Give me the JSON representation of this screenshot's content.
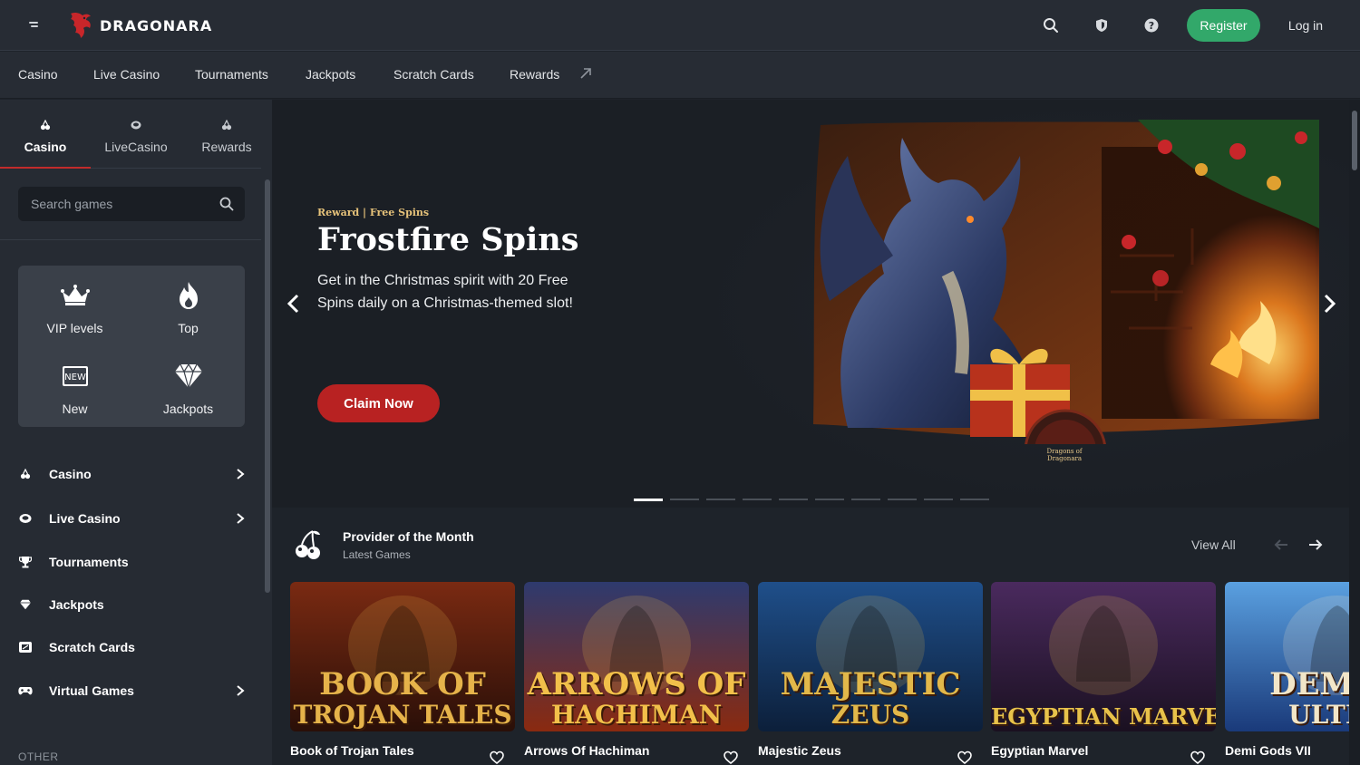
{
  "brand": {
    "name": "DRAGONARA"
  },
  "header": {
    "register_label": "Register",
    "login_label": "Log in",
    "icons": [
      "search-icon",
      "shield-icon",
      "help-icon"
    ]
  },
  "nav": {
    "items": [
      "Casino",
      "Live Casino",
      "Tournaments",
      "Jackpots",
      "Scratch Cards",
      "Rewards"
    ]
  },
  "sidebar": {
    "tabs": [
      {
        "label": "Casino",
        "icon": "cherries-icon",
        "active": true
      },
      {
        "label": "LiveCasino",
        "icon": "chip-icon",
        "active": false
      },
      {
        "label": "Rewards",
        "icon": "gift-icon",
        "active": false
      }
    ],
    "search": {
      "placeholder": "Search games",
      "value": ""
    },
    "quick": [
      {
        "label": "VIP levels",
        "icon": "crown-icon"
      },
      {
        "label": "Top",
        "icon": "flame-icon"
      },
      {
        "label": "New",
        "icon": "new-badge-icon"
      },
      {
        "label": "Jackpots",
        "icon": "diamond-icon"
      }
    ],
    "links": [
      {
        "label": "Casino",
        "icon": "cherries-icon",
        "expandable": true
      },
      {
        "label": "Live Casino",
        "icon": "chip-icon",
        "expandable": true
      },
      {
        "label": "Tournaments",
        "icon": "trophy-icon",
        "expandable": false
      },
      {
        "label": "Jackpots",
        "icon": "diamond-icon",
        "expandable": false
      },
      {
        "label": "Scratch Cards",
        "icon": "ticket-icon",
        "expandable": false
      },
      {
        "label": "Virtual Games",
        "icon": "gamepad-icon",
        "expandable": true
      }
    ],
    "other_label": "OTHER"
  },
  "hero": {
    "tag": "Reward | Free Spins",
    "title": "Frostfire Spins",
    "description": "Get in the Christmas spirit with 20 Free Spins daily on a Christmas-themed slot!",
    "cta": "Claim Now",
    "slide_count": 10,
    "active_slide": 1,
    "seal_text": "Dragons of Dragonara"
  },
  "provider_section": {
    "title": "Provider of the Month",
    "subtitle": "Latest Games",
    "view_all": "View All"
  },
  "games": [
    {
      "name": "Book of Trojan Tales",
      "art_line1": "BOOK OF",
      "art_line2": "TROJAN TALES",
      "bg1": "#7a2a12",
      "bg2": "#2a0f08",
      "accent": "#e6b34a"
    },
    {
      "name": "Arrows Of Hachiman",
      "art_line1": "ARROWS OF",
      "art_line2": "HACHIMAN",
      "bg1": "#2e3a6e",
      "bg2": "#8a2a10",
      "accent": "#f2c04a"
    },
    {
      "name": "Majestic Zeus",
      "art_line1": "MAJESTIC",
      "art_line2": "ZEUS",
      "bg1": "#1f4f8a",
      "bg2": "#0c1f3a",
      "accent": "#e2b84a"
    },
    {
      "name": "Egyptian Marvel",
      "art_line1": "EGYPTIAN MARVEL",
      "art_line2": "",
      "bg1": "#4a2a5e",
      "bg2": "#1a1020",
      "accent": "#e8c24a"
    },
    {
      "name": "Demi Gods VII",
      "art_line1": "DEMI G",
      "art_line2": "ULTRA",
      "bg1": "#5aa0e0",
      "bg2": "#1a3a7a",
      "accent": "#f2e6c8"
    }
  ],
  "colors": {
    "accent_red": "#b82222",
    "register_green": "#32a86a",
    "bg": "#1e232a",
    "panel": "#262b33"
  }
}
